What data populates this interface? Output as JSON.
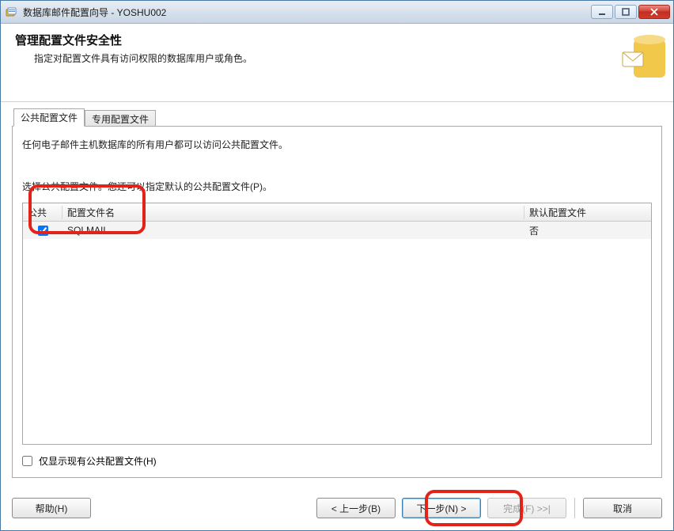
{
  "window": {
    "title": "数据库邮件配置向导 - YOSHU002"
  },
  "header": {
    "title": "管理配置文件安全性",
    "subtitle": "指定对配置文件具有访问权限的数据库用户或角色。"
  },
  "tabs": {
    "public": "公共配置文件",
    "private": "专用配置文件"
  },
  "panel": {
    "description": "任何电子邮件主机数据库的所有用户都可以访问公共配置文件。",
    "instruction": "选择公共配置文件。您还可以指定默认的公共配置文件(P)。"
  },
  "grid": {
    "columns": {
      "public": "公共",
      "name": "配置文件名",
      "default": "默认配置文件"
    },
    "rows": [
      {
        "checked": true,
        "name": "SQLMAIL",
        "default": "否"
      }
    ]
  },
  "filter": {
    "label": "仅显示现有公共配置文件(H)"
  },
  "buttons": {
    "help": "帮助(H)",
    "back": "< 上一步(B)",
    "next": "下一步(N) >",
    "finish": "完成(F) >>|",
    "cancel": "取消"
  }
}
